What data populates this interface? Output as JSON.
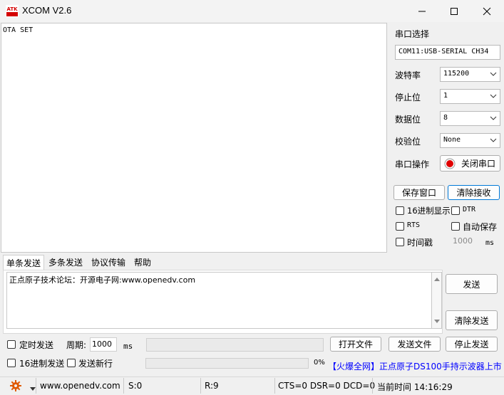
{
  "window": {
    "logo_text": "ATK",
    "title": "XCOM V2.6"
  },
  "receive": {
    "text": "OTA SET"
  },
  "serial": {
    "port_select_label": "串口选择",
    "port_value": "COM11:USB-SERIAL CH34",
    "baud_label": "波特率",
    "baud_value": "115200",
    "stop_label": "停止位",
    "stop_value": "1",
    "data_label": "数据位",
    "data_value": "8",
    "parity_label": "校验位",
    "parity_value": "None",
    "op_label": "串口操作",
    "close_port_button": "关闭串口",
    "status_color": "#e00000"
  },
  "recv_controls": {
    "save_window": "保存窗口",
    "clear_receive": "清除接收",
    "hex_display": "16进制显示",
    "dtr": "DTR",
    "rts": "RTS",
    "auto_save": "自动保存",
    "timestamp": "时间戳",
    "timestamp_value": "1000",
    "timestamp_unit": "ms"
  },
  "tabs": [
    "单条发送",
    "多条发送",
    "协议传输",
    "帮助"
  ],
  "send": {
    "text": "正点原子技术论坛：开源电子网:www.openedv.com",
    "send_button": "发送",
    "clear_send_button": "清除发送",
    "timed_send": "定时发送",
    "period_label": "周期:",
    "period_value": "1000",
    "period_unit": "ms",
    "open_file": "打开文件",
    "send_file": "发送文件",
    "stop_send": "停止发送",
    "hex_send": "16进制发送",
    "send_newline": "发送新行",
    "progress_percent": "0%",
    "progress_value": 0
  },
  "ad": {
    "text": "【火爆全网】正点原子DS100手持示波器上市"
  },
  "status": {
    "url": "www.openedv.com",
    "sent": "S:0",
    "received": "R:9",
    "lines": "CTS=0 DSR=0 DCD=0",
    "time": "当前时间 14:16:29"
  },
  "icons": {
    "gear_color": "#e05a00"
  }
}
